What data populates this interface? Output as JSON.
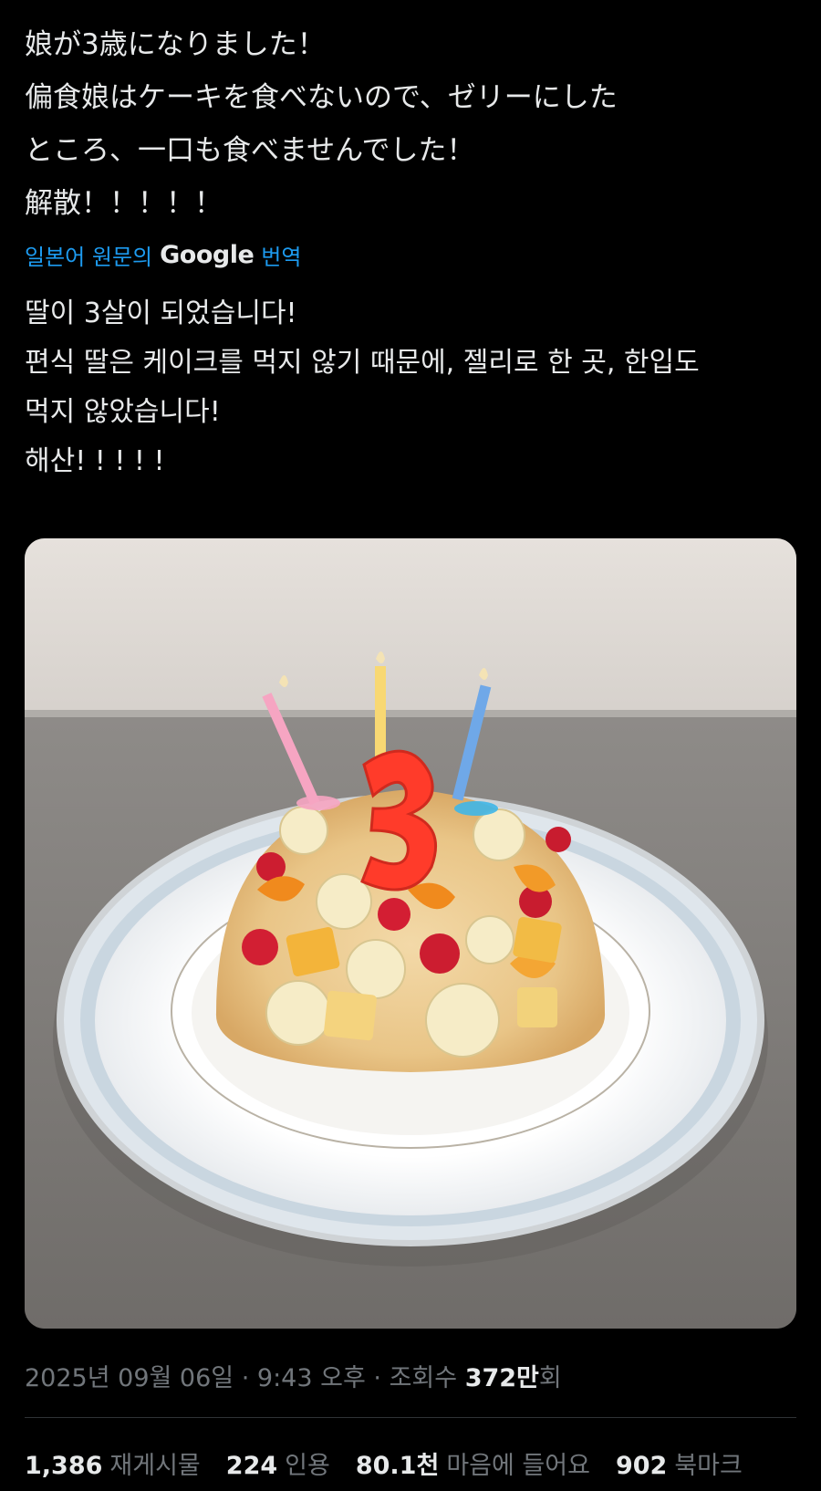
{
  "tweet": {
    "original_lines": [
      "娘が3歳になりました！",
      "偏食娘はケーキを食べないので、ゼリーにした",
      "ところ、一口も食べませんでした！",
      "解散！！！！！"
    ],
    "translate": {
      "label": "일본어 원문의",
      "brand": "Google",
      "action": "번역"
    },
    "translated_lines": [
      "딸이 3살이 되었습니다!",
      "편식 딸은 케이크를 먹지 않기 때문에, 젤리로 한 곳, 한입도",
      "먹지 않았습니다!",
      "해산! ! ! ! !"
    ],
    "meta": {
      "date": "2025년 09월 06일",
      "time": "9:43 오후",
      "views_label": "조회수",
      "views_number": "372만",
      "views_suffix": "회"
    },
    "stats": {
      "retweets": {
        "count": "1,386",
        "label": "재게시물"
      },
      "quotes": {
        "count": "224",
        "label": "인용"
      },
      "likes": {
        "count": "80.1천",
        "label": "마음에 들어요"
      },
      "bookmarks": {
        "count": "902",
        "label": "북마크"
      }
    }
  },
  "colors": {
    "background": "#000000",
    "text": "#e7e9ea",
    "muted": "#71767b",
    "link": "#1d9bf0",
    "divider": "#2f3336"
  }
}
